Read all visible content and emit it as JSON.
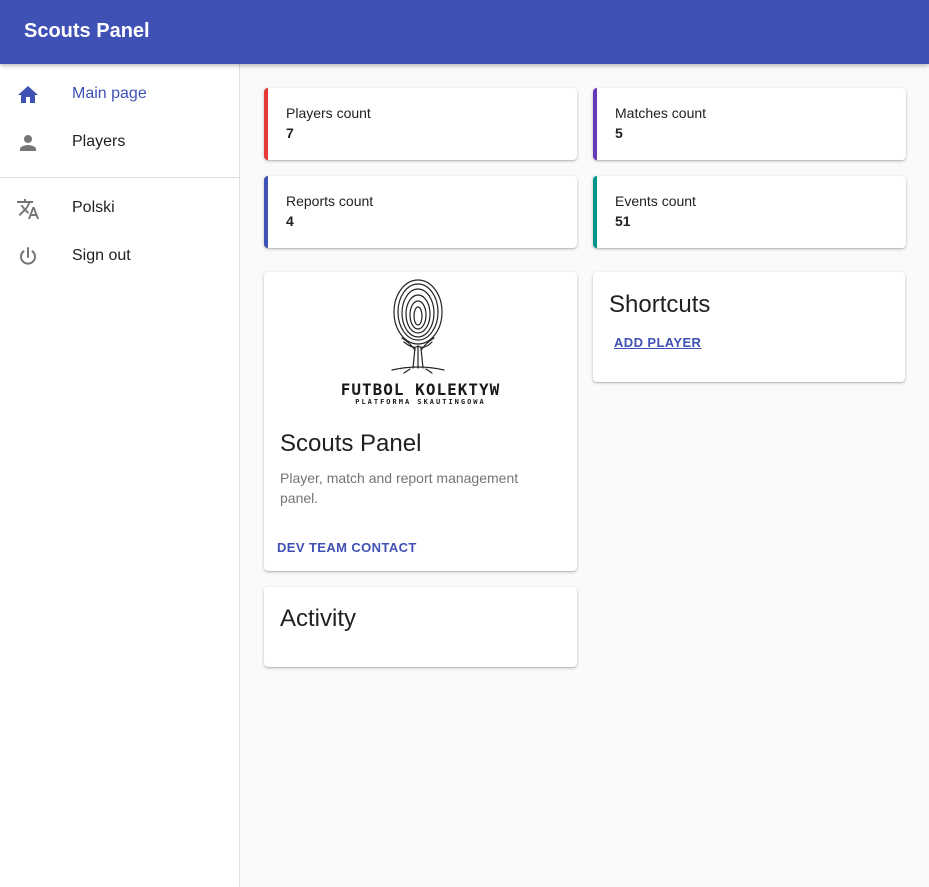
{
  "appbar": {
    "title": "Scouts Panel",
    "color": "#3f51b5"
  },
  "sidebar": {
    "items": [
      {
        "label": "Main page",
        "icon": "home-icon",
        "active": true
      },
      {
        "label": "Players",
        "icon": "person-icon"
      },
      {
        "label": "Polski",
        "icon": "translate-icon"
      },
      {
        "label": "Sign out",
        "icon": "power-icon"
      }
    ]
  },
  "stats": [
    {
      "label": "Players count",
      "value": "7",
      "color": "#e53935"
    },
    {
      "label": "Matches count",
      "value": "5",
      "color": "#673ab7"
    },
    {
      "label": "Reports count",
      "value": "4",
      "color": "#3f51b5"
    },
    {
      "label": "Events count",
      "value": "51",
      "color": "#009688"
    }
  ],
  "about": {
    "logo": {
      "brand": "FUTBOL KOLEKTYW",
      "tagline": "PLATFORMA SKAUTINGOWA",
      "icon": "fingerprint-tree-icon"
    },
    "title": "Scouts Panel",
    "description": "Player, match and report management panel.",
    "action_label": "DEV TEAM CONTACT"
  },
  "shortcuts": {
    "title": "Shortcuts",
    "links": [
      "ADD PLAYER"
    ]
  },
  "activity": {
    "title": "Activity"
  }
}
